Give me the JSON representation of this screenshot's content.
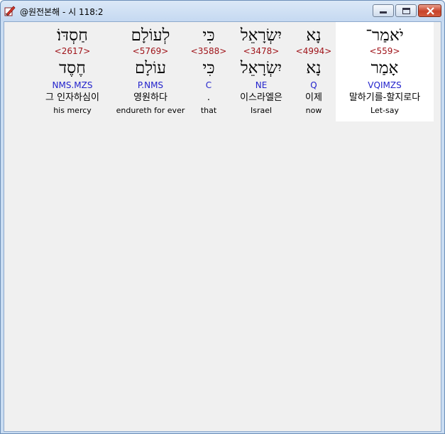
{
  "window": {
    "title": "@원전본해 - 시 118:2",
    "icon": "bible-app-icon"
  },
  "words": [
    {
      "hebrew": "חַסְדּוֹ׃",
      "strong": "<2617>",
      "lemma": "חֶסֶד",
      "morph": "NMS.MZS",
      "korean": "그 인자하심이",
      "english": "his mercy",
      "selected": false
    },
    {
      "hebrew": "לְעוֹלָם",
      "strong": "<5769>",
      "lemma": "עוֹלָם",
      "morph": "P.NMS",
      "korean": "영원하다",
      "english": "endureth for ever",
      "selected": false
    },
    {
      "hebrew": "כִּי",
      "strong": "<3588>",
      "lemma": "כִּי",
      "morph": "C",
      "korean": ".",
      "english": "that",
      "selected": false
    },
    {
      "hebrew": "יִשְׂרָאֵל",
      "strong": "<3478>",
      "lemma": "יִשְׂרָאֵל",
      "morph": "NE",
      "korean": "이스라엘은",
      "english": "Israel",
      "selected": false
    },
    {
      "hebrew": "נָא",
      "strong": "<4994>",
      "lemma": "נָא",
      "morph": "Q",
      "korean": "이제",
      "english": "now",
      "selected": false
    },
    {
      "hebrew": "יֹאמַר־",
      "strong": "<559>",
      "lemma": "אָמַר",
      "morph": "VQIMZS",
      "korean": "말하기를-할지로다",
      "english": "Let-say",
      "selected": true
    }
  ],
  "colors": {
    "strong_number": "#a0151b",
    "morphology": "#2222cc",
    "selected_background": "#ffffff",
    "client_background": "#f0f0f0"
  }
}
